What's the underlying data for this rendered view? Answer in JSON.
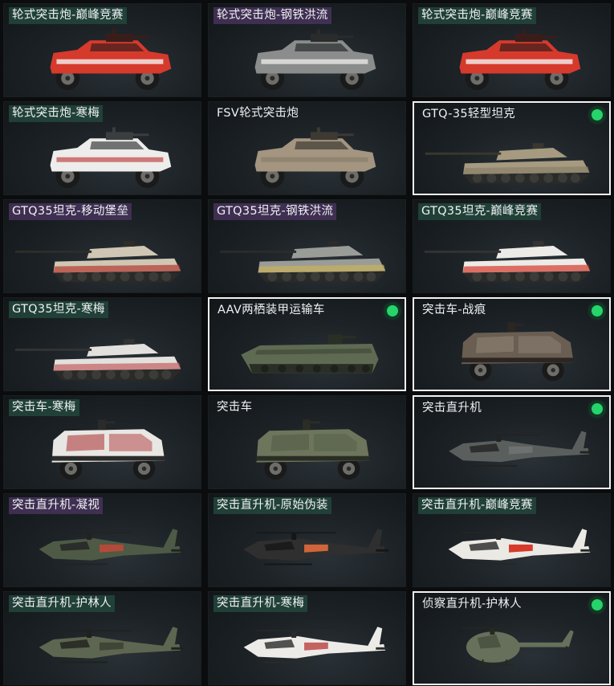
{
  "cards": [
    {
      "label": "轮式突击炮-巅峰竞赛",
      "kind": "car",
      "tag": "green",
      "selected": false,
      "owned": false,
      "palette": {
        "body": "#d63a2c",
        "accent": "#f2f2f2",
        "dark": "#3a1d1a"
      }
    },
    {
      "label": "轮式突击炮-钢铁洪流",
      "kind": "car",
      "tag": "purple",
      "selected": false,
      "owned": false,
      "palette": {
        "body": "#8a8d8c",
        "accent": "#e9e9e6",
        "dark": "#2a2c2c"
      }
    },
    {
      "label": "轮式突击炮-巅峰竞赛",
      "kind": "car",
      "tag": "green",
      "selected": false,
      "owned": false,
      "palette": {
        "body": "#d63a2c",
        "accent": "#f2f2f2",
        "dark": "#3a1d1a"
      }
    },
    {
      "label": "轮式突击炮-寒梅",
      "kind": "car",
      "tag": "green",
      "selected": false,
      "owned": false,
      "palette": {
        "body": "#ededeb",
        "accent": "#c65b5b",
        "dark": "#3b3e3f"
      }
    },
    {
      "label": "FSV轮式突击炮",
      "kind": "car",
      "tag": "plain",
      "selected": false,
      "owned": false,
      "palette": {
        "body": "#a39580",
        "accent": "#8c806c",
        "dark": "#3c3a33"
      }
    },
    {
      "label": "GTQ-35轻型坦克",
      "kind": "tank",
      "tag": "plain",
      "selected": true,
      "owned": true,
      "palette": {
        "body": "#a69a80",
        "accent": "#8a7f68",
        "dark": "#3a3730"
      }
    },
    {
      "label": "GTQ35坦克-移动堡垒",
      "kind": "tank",
      "tag": "purple",
      "selected": false,
      "owned": false,
      "palette": {
        "body": "#cfc7b4",
        "accent": "#b43a30",
        "dark": "#2f2d28"
      }
    },
    {
      "label": "GTQ35坦克-钢铁洪流",
      "kind": "tank",
      "tag": "purple",
      "selected": false,
      "owned": false,
      "palette": {
        "body": "#9a9c98",
        "accent": "#c9b25a",
        "dark": "#2b2c2a"
      }
    },
    {
      "label": "GTQ35坦克-巅峰竞赛",
      "kind": "tank",
      "tag": "green",
      "selected": false,
      "owned": false,
      "palette": {
        "body": "#ecebe7",
        "accent": "#d63a2c",
        "dark": "#333"
      }
    },
    {
      "label": "GTQ35坦克-寒梅",
      "kind": "tank",
      "tag": "green",
      "selected": false,
      "owned": false,
      "palette": {
        "body": "#e3e1dd",
        "accent": "#c26060",
        "dark": "#333"
      }
    },
    {
      "label": "AAV两栖装甲运输车",
      "kind": "aav",
      "tag": "plain",
      "selected": true,
      "owned": true,
      "palette": {
        "body": "#5f6a52",
        "accent": "#4a5340",
        "dark": "#2a2f25"
      }
    },
    {
      "label": "突击车-战痕",
      "kind": "mrap",
      "tag": "plain",
      "selected": true,
      "owned": true,
      "palette": {
        "body": "#6a5e53",
        "accent": "#8a7d70",
        "dark": "#2b2622"
      }
    },
    {
      "label": "突击车-寒梅",
      "kind": "mrap",
      "tag": "green",
      "selected": false,
      "owned": false,
      "palette": {
        "body": "#e8e7e3",
        "accent": "#b75656",
        "dark": "#2b2b2b"
      }
    },
    {
      "label": "突击车",
      "kind": "mrap",
      "tag": "plain",
      "selected": false,
      "owned": false,
      "palette": {
        "body": "#6d765c",
        "accent": "#58604a",
        "dark": "#2a2d24"
      }
    },
    {
      "label": "突击直升机",
      "kind": "heli",
      "tag": "plain",
      "selected": true,
      "owned": true,
      "palette": {
        "body": "#5a5f5e",
        "accent": "#6d7271",
        "dark": "#222"
      }
    },
    {
      "label": "突击直升机-凝视",
      "kind": "heli",
      "tag": "purple",
      "selected": false,
      "owned": false,
      "palette": {
        "body": "#4e5a45",
        "accent": "#b24a3a",
        "dark": "#222"
      }
    },
    {
      "label": "突击直升机-原始伪装",
      "kind": "heli",
      "tag": "green",
      "selected": false,
      "owned": false,
      "palette": {
        "body": "#2f2f2f",
        "accent": "#d0643a",
        "dark": "#161616"
      }
    },
    {
      "label": "突击直升机-巅峰竞赛",
      "kind": "heli",
      "tag": "green",
      "selected": false,
      "owned": false,
      "palette": {
        "body": "#ebe9e4",
        "accent": "#d63a2c",
        "dark": "#262626"
      }
    },
    {
      "label": "突击直升机-护林人",
      "kind": "heli",
      "tag": "green",
      "selected": false,
      "owned": false,
      "palette": {
        "body": "#5d6650",
        "accent": "#3f4636",
        "dark": "#1f221b"
      }
    },
    {
      "label": "突击直升机-寒梅",
      "kind": "heli",
      "tag": "green",
      "selected": false,
      "owned": false,
      "palette": {
        "body": "#ecebe7",
        "accent": "#c46262",
        "dark": "#2a2a2a"
      }
    },
    {
      "label": "侦察直升机-护林人",
      "kind": "scout",
      "tag": "plain",
      "selected": true,
      "owned": true,
      "palette": {
        "body": "#66705a",
        "accent": "#4c5443",
        "dark": "#25291f"
      }
    }
  ]
}
